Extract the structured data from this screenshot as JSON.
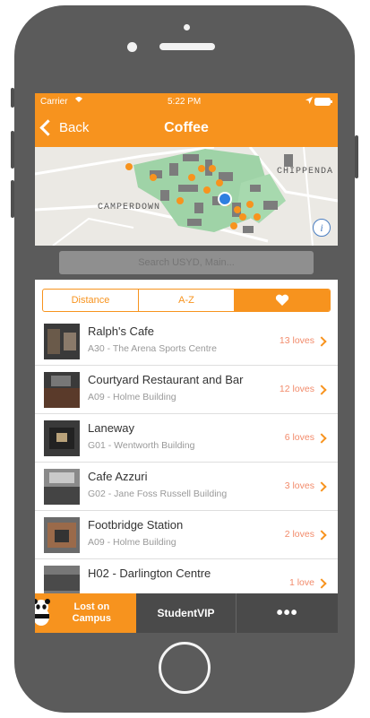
{
  "status": {
    "carrier": "Carrier",
    "time": "5:22 PM"
  },
  "nav": {
    "back_label": "Back",
    "title": "Coffee"
  },
  "map": {
    "labels": [
      "CHIPPENDA",
      "CAMPERDOWN"
    ]
  },
  "search": {
    "placeholder": "Search USYD, Main..."
  },
  "segments": {
    "distance": "Distance",
    "az": "A-Z",
    "favourites_icon": "heart-icon"
  },
  "list": [
    {
      "name": "Ralph's Cafe",
      "location": "A30 - The Arena Sports Centre",
      "loves": "13 loves"
    },
    {
      "name": "Courtyard Restaurant and Bar",
      "location": "A09 - Holme Building",
      "loves": "12 loves"
    },
    {
      "name": "Laneway",
      "location": "G01 - Wentworth Building",
      "loves": "6 loves"
    },
    {
      "name": "Cafe Azzuri",
      "location": "G02 - Jane Foss Russell Building",
      "loves": "3 loves"
    },
    {
      "name": "Footbridge Station",
      "location": "A09 - Holme Building",
      "loves": "2 loves"
    },
    {
      "name": "H02 - Darlington Centre",
      "location": "",
      "loves": "1 love"
    }
  ],
  "tabs": {
    "lost": "Lost on Campus",
    "studentvip": "StudentVIP",
    "more": "•••"
  },
  "colors": {
    "accent": "#f7931e",
    "phone": "#5b5b5b",
    "tabbar": "#4a4a4a"
  }
}
